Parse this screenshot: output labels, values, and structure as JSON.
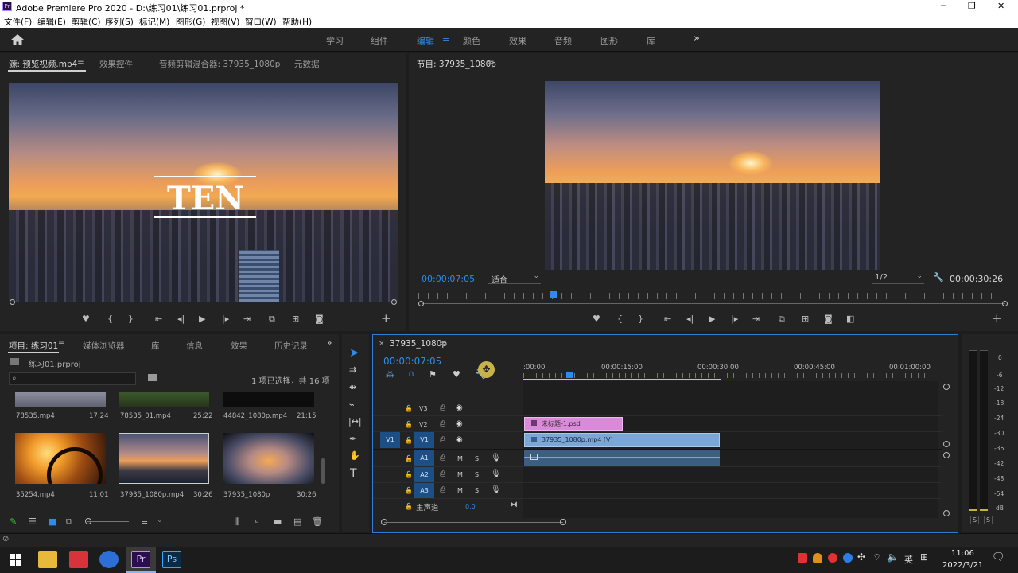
{
  "titlebar": {
    "title": "Adobe Premiere Pro 2020 - D:\\练习01\\练习01.prproj *",
    "minimize": "─",
    "maximize": "❐",
    "close": "✕"
  },
  "menu": [
    "文件(F)",
    "编辑(E)",
    "剪辑(C)",
    "序列(S)",
    "标记(M)",
    "图形(G)",
    "视图(V)",
    "窗口(W)",
    "帮助(H)"
  ],
  "workspaces": {
    "items": [
      "学习",
      "组件",
      "编辑",
      "颜色",
      "效果",
      "音频",
      "图形",
      "库"
    ],
    "active": "编辑",
    "more": "»"
  },
  "source": {
    "tabs": [
      "源: 预览视频.mp4",
      "效果控件",
      "音频剪辑混合器: 37935_1080p",
      "元数据"
    ],
    "overlay_text": "TEN"
  },
  "program": {
    "tab": "节目: 37935_1080p",
    "timecode": "00:00:07:05",
    "fit": "适合",
    "resolution": "1/2",
    "duration": "00:00:30:26"
  },
  "project": {
    "tabs": [
      "项目: 练习01",
      "媒体浏览器",
      "库",
      "信息",
      "效果",
      "历史记录"
    ],
    "file": "练习01.prproj",
    "selection": "1 项已选择，共 16 项",
    "items": [
      {
        "name": "78535.mp4",
        "dur": "17:24"
      },
      {
        "name": "78535_01.mp4",
        "dur": "25:22"
      },
      {
        "name": "44842_1080p.mp4",
        "dur": "21:15"
      },
      {
        "name": "35254.mp4",
        "dur": "11:01"
      },
      {
        "name": "37935_1080p.mp4",
        "dur": "30:26"
      },
      {
        "name": "37935_1080p",
        "dur": "30:26"
      }
    ]
  },
  "timeline": {
    "tab": "37935_1080p",
    "timecode": "00:00:07:05",
    "ruler": [
      ":00:00",
      "00:00:15:00",
      "00:00:30:00",
      "00:00:45:00",
      "00:01:00:00"
    ],
    "tracks": [
      "V3",
      "V2",
      "V1",
      "A1",
      "A2",
      "A3"
    ],
    "source_patch_v": "V1",
    "master": "主声道",
    "master_val": "0.0",
    "clips": {
      "v2": "未标题-1.psd",
      "v1": "37935_1080p.mp4 [V]"
    },
    "m": "M",
    "s": "S"
  },
  "meter": {
    "labels": [
      "0",
      "-6",
      "-12",
      "-18",
      "-24",
      "-30",
      "-36",
      "-42",
      "-48",
      "-54",
      "dB"
    ],
    "solo": "S"
  },
  "tray": {
    "ime": "英",
    "time": "11:06",
    "date": "2022/3/21"
  }
}
